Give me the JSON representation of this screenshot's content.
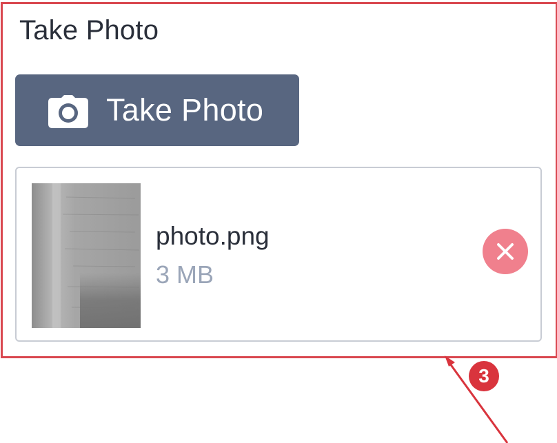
{
  "section": {
    "title": "Take Photo"
  },
  "take_photo_button": {
    "label": "Take Photo",
    "icon": "camera-icon",
    "color": "#586680"
  },
  "file": {
    "name": "photo.png",
    "size": "3 MB",
    "remove_icon": "close-icon",
    "remove_color": "#f0808d"
  },
  "annotation": {
    "step_number": "3",
    "color": "#d9343d"
  }
}
